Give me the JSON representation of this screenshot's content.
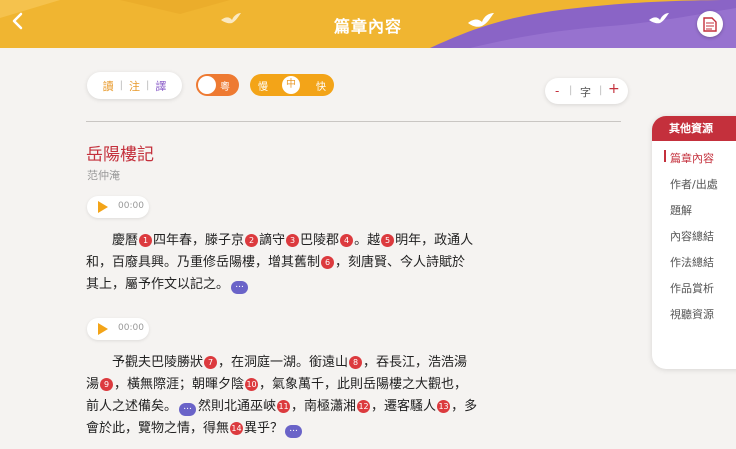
{
  "header": {
    "title": "篇章內容",
    "colors": {
      "left": "#f0b531",
      "right": "#8a64c6"
    }
  },
  "controls": {
    "mode_tabs": [
      "讀",
      "注",
      "譯"
    ],
    "dialect_toggle_label": "粵",
    "speed": {
      "slow": "慢",
      "mid": "中",
      "fast": "快"
    },
    "font_size": {
      "minus": "-",
      "label": "字",
      "plus": "+"
    }
  },
  "article": {
    "title": "岳陽樓記",
    "author": "范仲淹",
    "audio_time": "00:00",
    "paragraphs": [
      {
        "lines": [
          [
            {
              "t": "　　慶曆"
            },
            {
              "n": "1"
            },
            {
              "t": "四年春，滕子京"
            },
            {
              "n": "2"
            },
            {
              "t": "謫守"
            },
            {
              "n": "3"
            },
            {
              "t": "巴陵郡"
            },
            {
              "n": "4"
            },
            {
              "t": "。越"
            },
            {
              "n": "5"
            },
            {
              "t": "明年，政通人"
            }
          ],
          [
            {
              "t": "和，百廢具興。乃重修岳陽樓，增其舊制"
            },
            {
              "n": "6"
            },
            {
              "t": "，刻唐賢、今人詩賦於"
            }
          ],
          [
            {
              "t": "其上，屬予作文以記之。"
            },
            {
              "b": "..."
            }
          ]
        ]
      },
      {
        "lines": [
          [
            {
              "t": "　　予觀夫巴陵勝狀"
            },
            {
              "n": "7"
            },
            {
              "t": "，在洞庭一湖。銜遠山"
            },
            {
              "n": "8"
            },
            {
              "t": "，吞長江，浩浩湯"
            }
          ],
          [
            {
              "t": "湯"
            },
            {
              "n": "9"
            },
            {
              "t": "，橫無際涯；朝暉夕陰"
            },
            {
              "n": "10"
            },
            {
              "t": "，氣象萬千，此則岳陽樓之大觀也，"
            }
          ],
          [
            {
              "t": "前人之述備矣。"
            },
            {
              "b": "..."
            },
            {
              "t": "然則北通巫峽"
            },
            {
              "n": "11"
            },
            {
              "t": "，南極瀟湘"
            },
            {
              "n": "12"
            },
            {
              "t": "，遷客騷人"
            },
            {
              "n": "13"
            },
            {
              "t": "，多"
            }
          ],
          [
            {
              "t": "會於此，覽物之情，得無"
            },
            {
              "n": "14"
            },
            {
              "t": "異乎？"
            },
            {
              "b": "..."
            }
          ]
        ]
      }
    ]
  },
  "sidebar": {
    "heading": "其他資源",
    "items": [
      "篇章內容",
      "作者/出處",
      "題解",
      "內容總結",
      "作法總結",
      "作品賞析",
      "視聽資源"
    ],
    "active_index": 0
  }
}
